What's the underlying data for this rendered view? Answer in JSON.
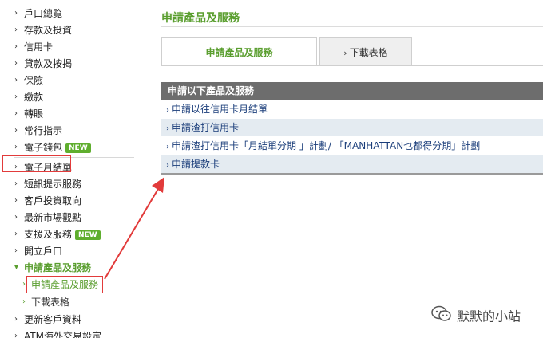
{
  "sidebar": {
    "items": [
      {
        "label": "戶口總覧"
      },
      {
        "label": "存款及投資"
      },
      {
        "label": "信用卡"
      },
      {
        "label": "貸款及按揭"
      },
      {
        "label": "保險"
      },
      {
        "label": "繳款"
      },
      {
        "label": "轉賬"
      },
      {
        "label": "常行指示"
      },
      {
        "label": "電子錢包",
        "badge": "NEW"
      },
      {
        "label": "電子月結單"
      },
      {
        "label": "短訊提示服務"
      },
      {
        "label": "客戶投資取向"
      },
      {
        "label": "最新市場觀點"
      },
      {
        "label": "支援及服務",
        "badge": "NEW"
      },
      {
        "label": "開立戶口"
      },
      {
        "label": "申請產品及服務"
      },
      {
        "label": "更新客戶資料"
      },
      {
        "label": "ATM海外交易設定"
      }
    ],
    "subitems": [
      {
        "label": "申請產品及服務"
      },
      {
        "label": "下載表格"
      }
    ]
  },
  "main": {
    "title": "申請產品及服務",
    "tabs": [
      {
        "label": "申請產品及服務"
      },
      {
        "label": "下載表格"
      }
    ],
    "panel_header": "申請以下產品及服務",
    "rows": [
      {
        "label": "申請以往信用卡月結單"
      },
      {
        "label": "申請渣打信用卡"
      },
      {
        "label": "申請渣打信用卡「月結單分期 」計劃/ 「MANHATTAN乜都得分期」計劃"
      },
      {
        "label": "申請提款卡"
      }
    ]
  },
  "watermark": {
    "text": "默默的小站"
  },
  "colors": {
    "accent_green": "#5a9e2f",
    "header_gray": "#6d6d6d",
    "row_blue": "#e4ebf1",
    "annotation_red": "#e23b3b"
  }
}
